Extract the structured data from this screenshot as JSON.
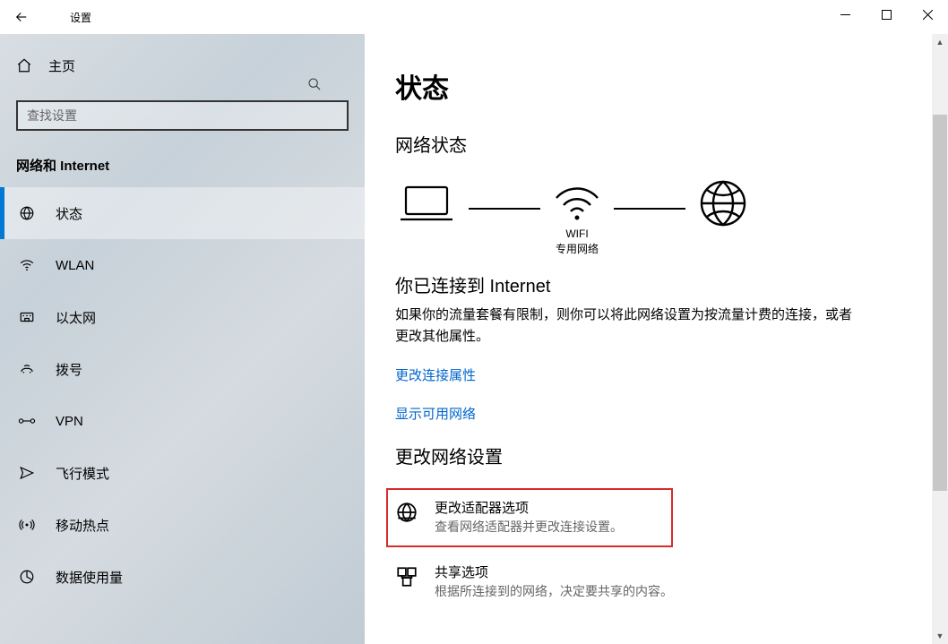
{
  "titlebar": {
    "title": "设置"
  },
  "sidebar": {
    "home": "主页",
    "search_placeholder": "查找设置",
    "section": "网络和 Internet",
    "items": [
      {
        "label": "状态",
        "icon": "globe"
      },
      {
        "label": "WLAN",
        "icon": "wifi"
      },
      {
        "label": "以太网",
        "icon": "ethernet"
      },
      {
        "label": "拨号",
        "icon": "dialup"
      },
      {
        "label": "VPN",
        "icon": "vpn"
      },
      {
        "label": "飞行模式",
        "icon": "airplane"
      },
      {
        "label": "移动热点",
        "icon": "hotspot"
      },
      {
        "label": "数据使用量",
        "icon": "data"
      }
    ]
  },
  "content": {
    "page_title": "状态",
    "network_status_heading": "网络状态",
    "diagram": {
      "wifi_label": "WIFI",
      "wifi_sub": "专用网络"
    },
    "connected_heading": "你已连接到 Internet",
    "connected_desc": "如果你的流量套餐有限制，则你可以将此网络设置为按流量计费的连接，或者更改其他属性。",
    "link_change_props": "更改连接属性",
    "link_show_networks": "显示可用网络",
    "change_settings_heading": "更改网络设置",
    "adapter_title": "更改适配器选项",
    "adapter_sub": "查看网络适配器并更改连接设置。",
    "sharing_title": "共享选项",
    "sharing_sub": "根据所连接到的网络，决定要共享的内容。"
  }
}
